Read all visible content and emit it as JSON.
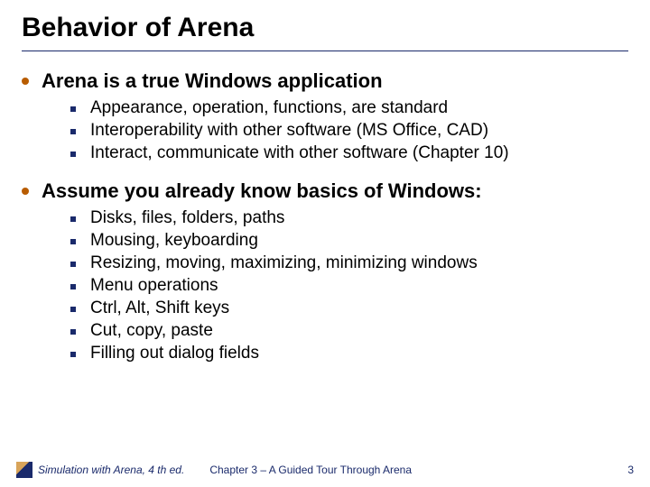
{
  "title": "Behavior of Arena",
  "bullets": [
    {
      "text": "Arena is a true Windows application",
      "subs": [
        "Appearance, operation, functions, are standard",
        "Interoperability with other software (MS Office, CAD)",
        "Interact, communicate with other software (Chapter 10)"
      ]
    },
    {
      "text": "Assume you already know basics of Windows:",
      "subs": [
        "Disks, files, folders, paths",
        "Mousing, keyboarding",
        "Resizing, moving, maximizing, minimizing windows",
        "Menu operations",
        "Ctrl, Alt, Shift keys",
        "Cut, copy, paste",
        "Filling out dialog fields"
      ]
    }
  ],
  "footer": {
    "left": "Simulation with Arena, 4 th ed.",
    "center": "Chapter 3 – A Guided Tour Through Arena",
    "page": "3"
  }
}
